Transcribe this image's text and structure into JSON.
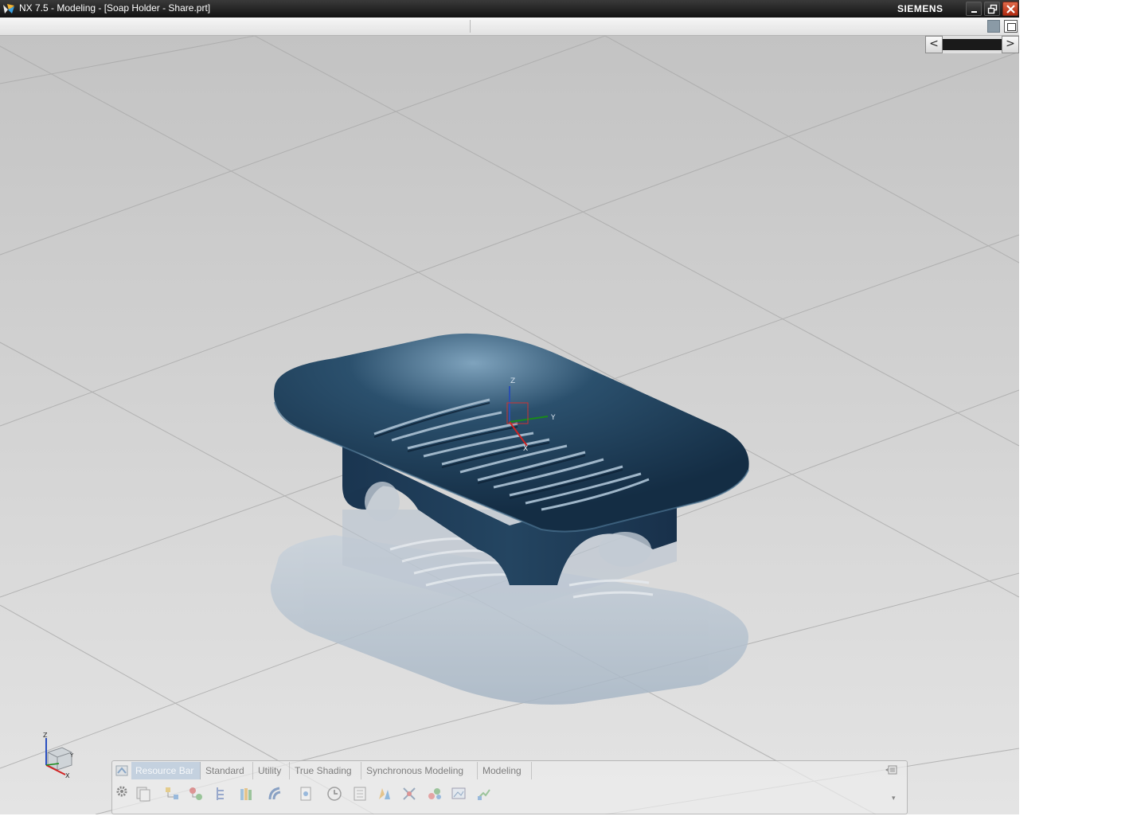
{
  "window": {
    "title": "NX 7.5 - Modeling - [Soap Holder - Share.prt]",
    "brand": "SIEMENS"
  },
  "icons": {
    "app_logo": "nx-logo-icon",
    "minimize": "minimize-icon",
    "restore": "restore-icon",
    "close": "close-icon",
    "grid_toggle": "grid-icon",
    "fit_view": "fit-view-icon",
    "scroll_left": "chevron-left-icon",
    "scroll_right": "chevron-right-icon",
    "view_triad": "wcs-triad-icon",
    "resource_bar": "resource-bar-icon",
    "gear": "gear-icon"
  },
  "scroller": {
    "left": "<",
    "right": ">"
  },
  "viewport": {
    "csys_labels": {
      "z": "Z",
      "y": "Y",
      "x": "X"
    },
    "triad_labels": {
      "z": "Z",
      "x": "X",
      "y": "Y"
    },
    "colors": {
      "background_top": "#c3c3c3",
      "background_bottom": "#e4e4e4",
      "part_color": "#1c3a55",
      "reflection_color": "#a9b8c7"
    }
  },
  "resource_bar": {
    "tabs": [
      {
        "label": "Resource Bar",
        "active": true
      },
      {
        "label": "Standard",
        "active": false
      },
      {
        "label": "Utility",
        "active": false
      },
      {
        "label": "True Shading",
        "active": false
      },
      {
        "label": "Synchronous Modeling",
        "active": false
      },
      {
        "label": "Modeling",
        "active": false
      }
    ],
    "tools": [
      "copy-icon",
      "assembly-navigator-icon",
      "constraint-navigator-icon",
      "part-navigator-icon",
      "reuse-library-icon",
      "web-browser-icon",
      "document-icon",
      "history-icon",
      "palette-icon",
      "role-icon",
      "system-materials-icon",
      "process-studio-icon",
      "visualization-icon",
      "template-icon"
    ]
  }
}
